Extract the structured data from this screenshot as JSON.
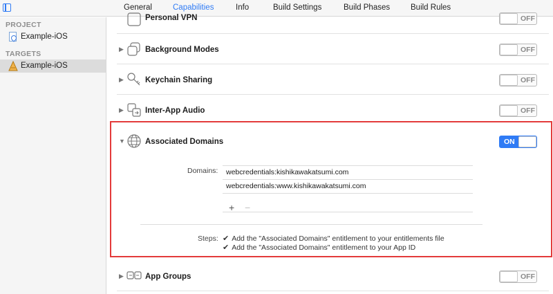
{
  "tabs": [
    {
      "label": "General"
    },
    {
      "label": "Capabilities"
    },
    {
      "label": "Info"
    },
    {
      "label": "Build Settings"
    },
    {
      "label": "Build Phases"
    },
    {
      "label": "Build Rules"
    }
  ],
  "active_tab": "Capabilities",
  "sidebar": {
    "project_header": "PROJECT",
    "project_item": "Example-iOS",
    "targets_header": "TARGETS",
    "target_item": "Example-iOS"
  },
  "capabilities": [
    {
      "title": "Personal VPN",
      "state": "OFF",
      "icon": "vpn-icon"
    },
    {
      "title": "Background Modes",
      "state": "OFF",
      "icon": "background-modes-icon"
    },
    {
      "title": "Keychain Sharing",
      "state": "OFF",
      "icon": "key-icon"
    },
    {
      "title": "Inter-App Audio",
      "state": "OFF",
      "icon": "audio-icon"
    },
    {
      "title": "Associated Domains",
      "state": "ON",
      "icon": "globe-icon"
    },
    {
      "title": "App Groups",
      "state": "OFF",
      "icon": "app-groups-icon"
    }
  ],
  "associated_domains": {
    "domains_label": "Domains:",
    "domains": [
      "webcredentials:kishikawakatsumi.com",
      "webcredentials:www.kishikawakatsumi.com"
    ],
    "add_symbol": "+",
    "remove_symbol": "−",
    "steps_label": "Steps:",
    "steps": [
      "Add the \"Associated Domains\" entitlement to your entitlements file",
      "Add the \"Associated Domains\" entitlement to your App ID"
    ],
    "check_symbol": "✔"
  },
  "colors": {
    "accent": "#2f7bf5",
    "highlight_border": "#e33a3a"
  }
}
